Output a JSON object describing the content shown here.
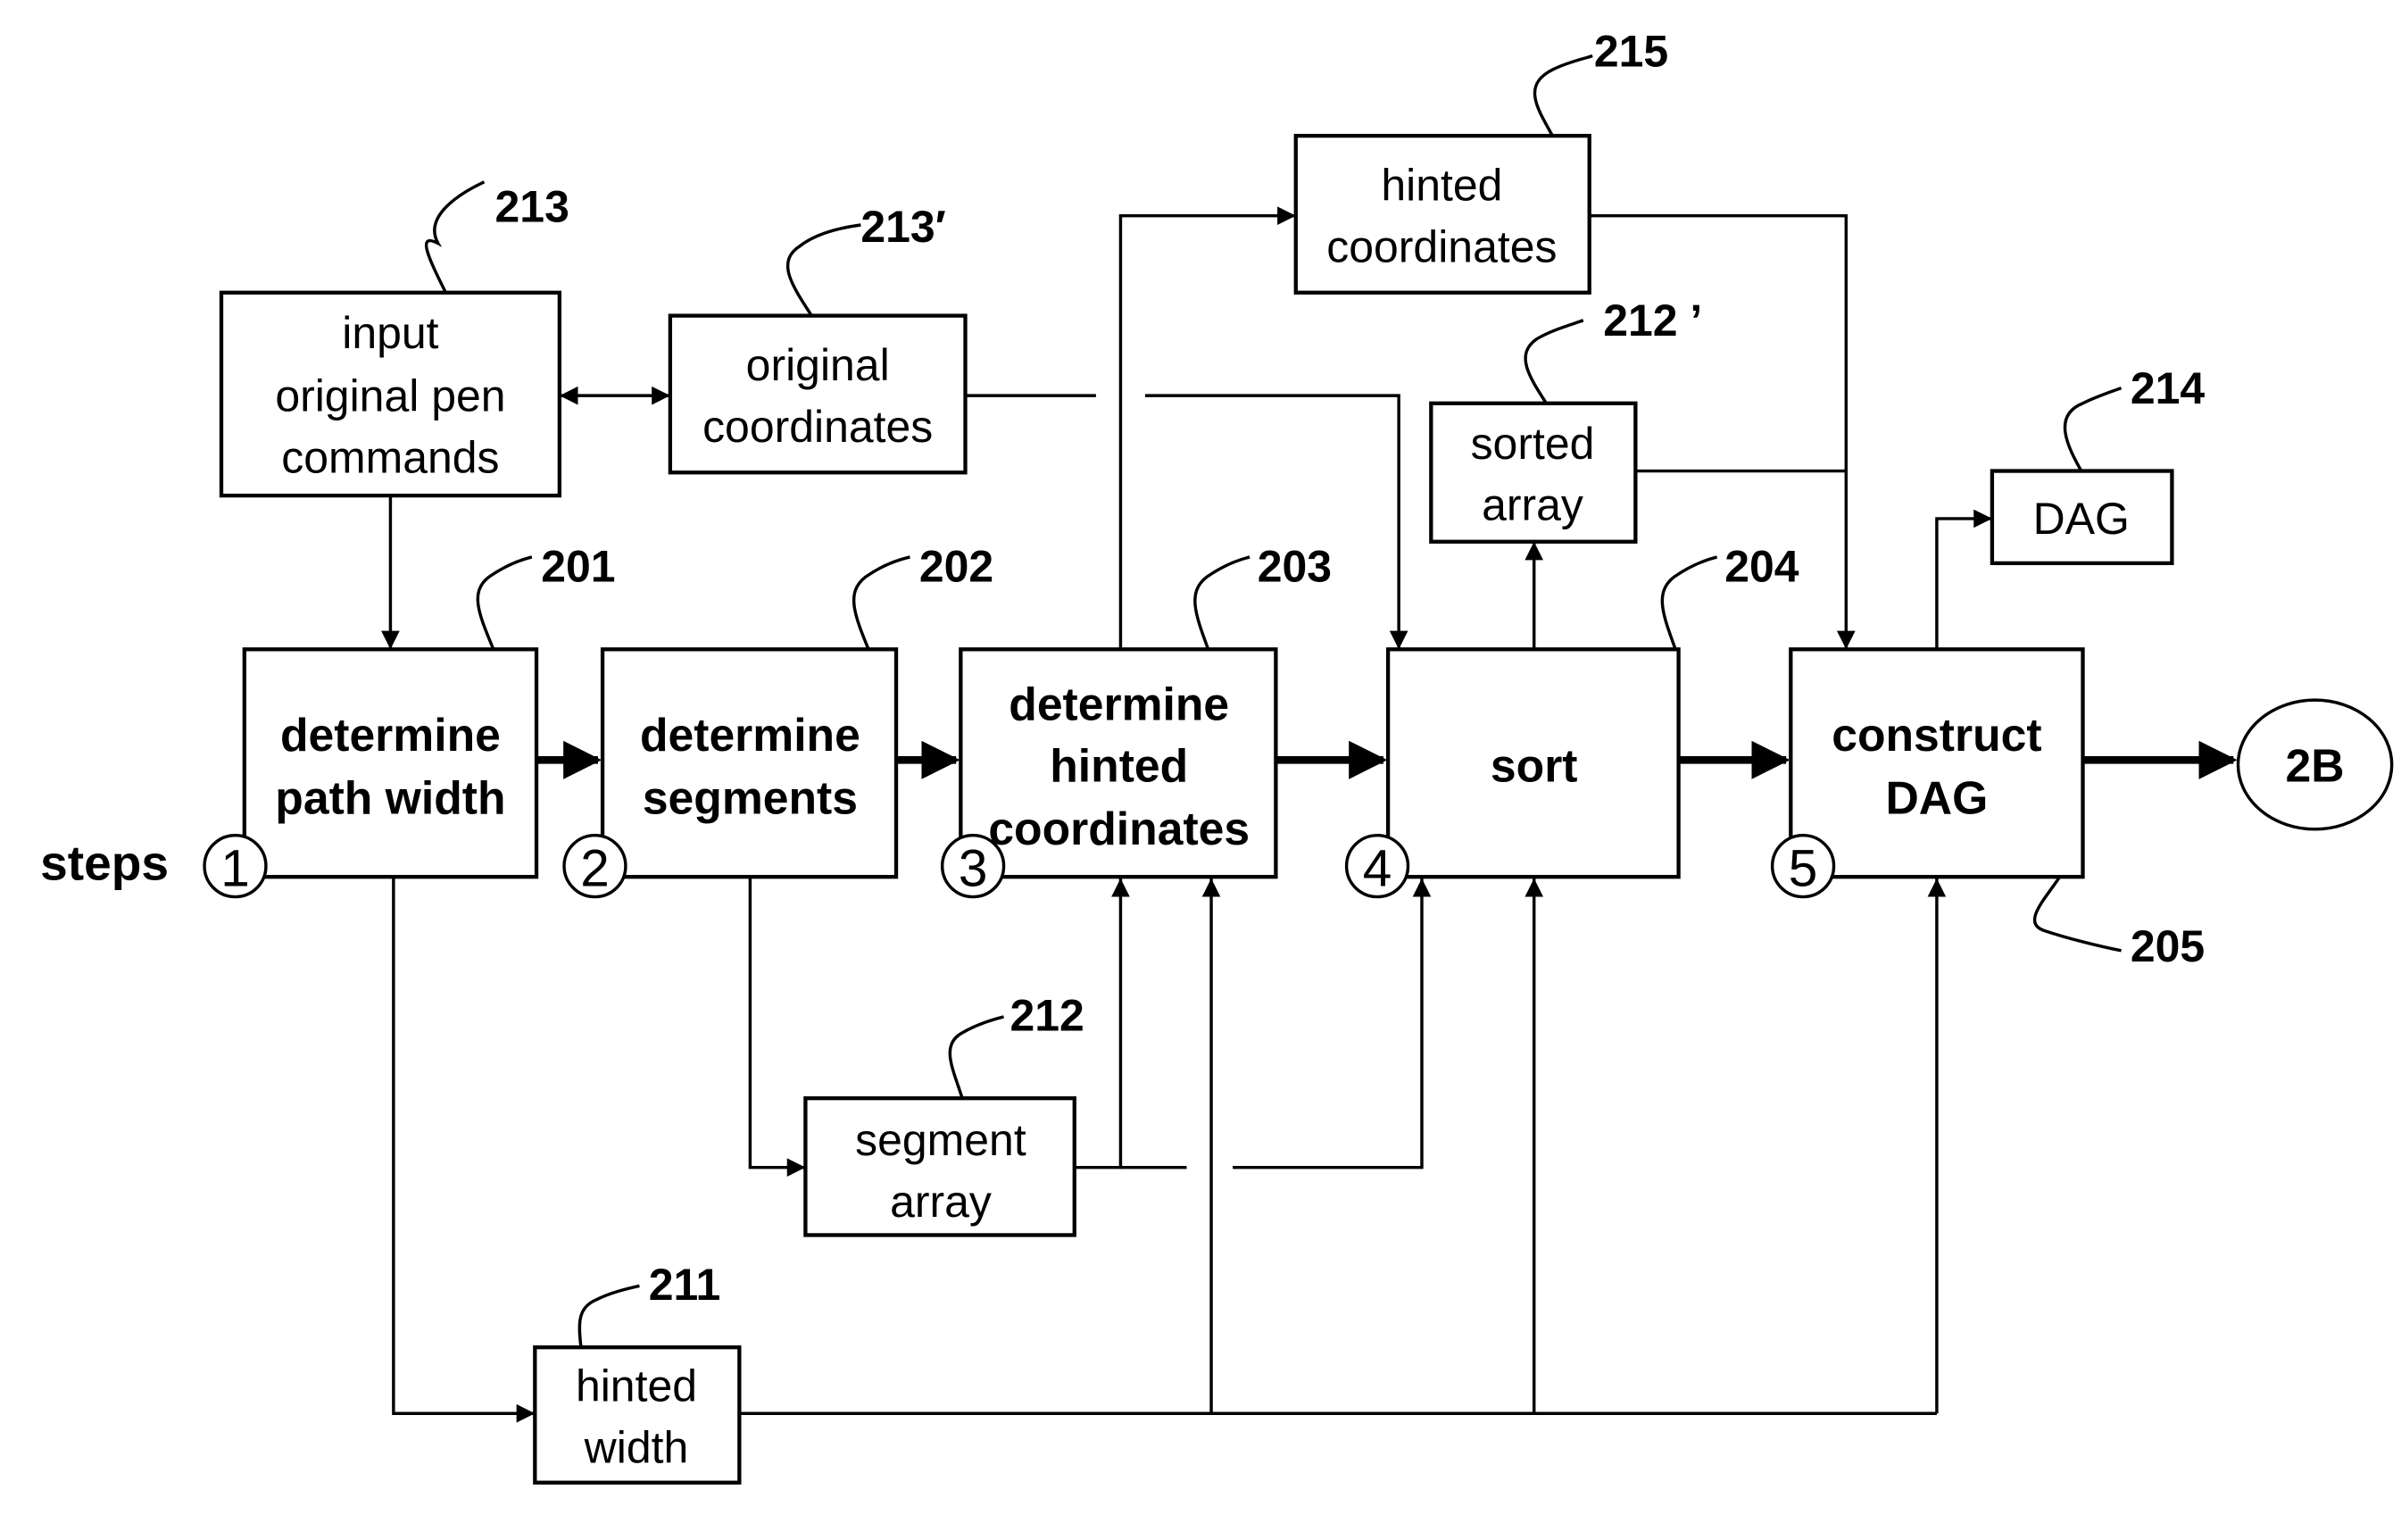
{
  "diagram": {
    "steps_label": "steps",
    "process_boxes": [
      {
        "id": "201",
        "lines": [
          "determine",
          "path width"
        ],
        "step": "1"
      },
      {
        "id": "202",
        "lines": [
          "determine",
          "segments"
        ],
        "step": "2"
      },
      {
        "id": "203",
        "lines": [
          "determine",
          "hinted",
          "coordinates"
        ],
        "step": "3"
      },
      {
        "id": "204",
        "lines": [
          "sort"
        ],
        "step": "4"
      },
      {
        "id": "205",
        "lines": [
          "construct",
          "DAG"
        ],
        "step": "5"
      }
    ],
    "data_boxes": [
      {
        "id": "213",
        "lines": [
          "input",
          "original pen",
          "commands"
        ]
      },
      {
        "id": "213′",
        "lines": [
          "original",
          "coordinates"
        ]
      },
      {
        "id": "215",
        "lines": [
          "hinted",
          "coordinates"
        ]
      },
      {
        "id": "212 ’",
        "lines": [
          "sorted",
          "array"
        ]
      },
      {
        "id": "214",
        "lines": [
          "DAG"
        ]
      },
      {
        "id": "212",
        "lines": [
          "segment",
          "array"
        ]
      },
      {
        "id": "211",
        "lines": [
          "hinted",
          "width"
        ]
      }
    ],
    "connector": {
      "label": "2B"
    }
  }
}
